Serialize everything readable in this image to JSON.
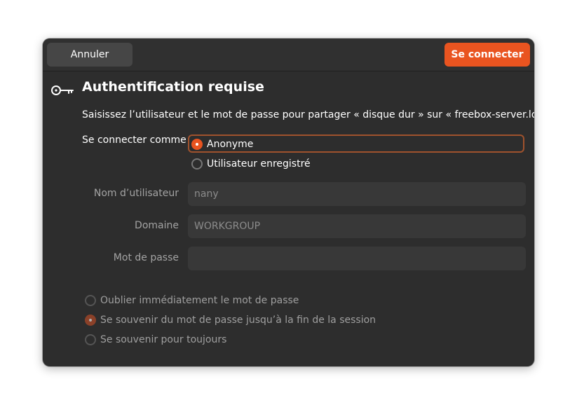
{
  "header": {
    "cancel_label": "Annuler",
    "connect_label": "Se connecter"
  },
  "dialog": {
    "icon": "key-icon",
    "title": "Authentification requise",
    "description": "Saisissez l’utilisateur et le mot de passe pour partager « disque dur » sur « freebox-server.local » :"
  },
  "connect_as": {
    "label": "Se connecter comme",
    "options": [
      {
        "label": "Anonyme",
        "selected": true
      },
      {
        "label": "Utilisateur enregistré",
        "selected": false
      }
    ]
  },
  "fields": {
    "username": {
      "label": "Nom d’utilisateur",
      "value": "nany"
    },
    "domain": {
      "label": "Domaine",
      "value": "WORKGROUP"
    },
    "password": {
      "label": "Mot de passe",
      "value": ""
    }
  },
  "remember": {
    "options": [
      {
        "label": "Oublier immédiatement le mot de passe",
        "selected": false
      },
      {
        "label": "Se souvenir du mot de passe jusqu’à la fin de la session",
        "selected": true
      },
      {
        "label": "Se souvenir pour toujours",
        "selected": false
      }
    ]
  },
  "colors": {
    "accent": "#e95420",
    "background": "#2d2d2d",
    "field": "#383838"
  }
}
